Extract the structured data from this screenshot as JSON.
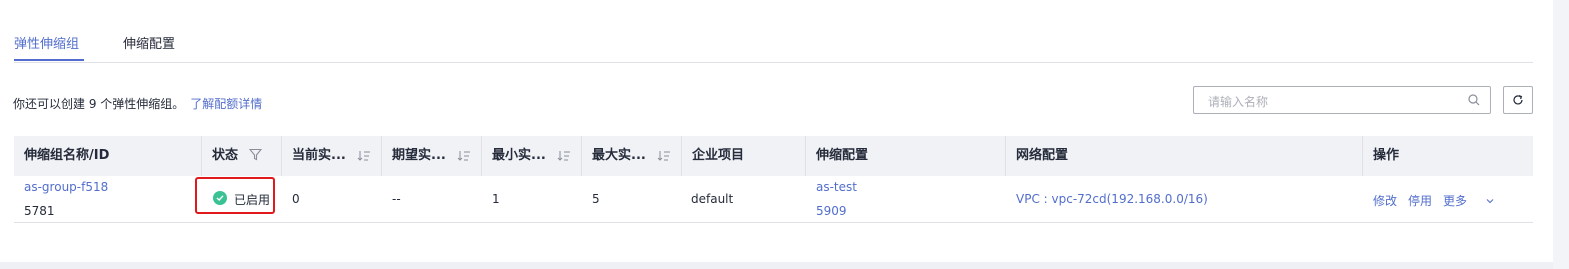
{
  "tabs": {
    "active": "弹性伸缩组",
    "other": "伸缩配置"
  },
  "info": {
    "text": "你还可以创建 9 个弹性伸缩组。",
    "link": "了解配额详情"
  },
  "search": {
    "placeholder": "请输入名称"
  },
  "table": {
    "headers": {
      "name": "伸缩组名称/ID",
      "status": "状态",
      "current": "当前实...",
      "desired": "期望实...",
      "min": "最小实...",
      "max": "最大实...",
      "project": "企业项目",
      "config": "伸缩配置",
      "network": "网络配置",
      "ops": "操作"
    },
    "row": {
      "name": "as-group-f518",
      "id": "5781",
      "status": "已启用",
      "current": "0",
      "desired": "--",
      "min": "1",
      "max": "5",
      "project": "default",
      "config_name": "as-test",
      "config_id": "5909",
      "network": "VPC : vpc-72cd(192.168.0.0/16)",
      "op_modify": "修改",
      "op_disable": "停用",
      "op_more": "更多"
    }
  },
  "colors": {
    "accent": "#526ecc",
    "status_green": "#3ac295",
    "highlight_red": "#e0191d"
  }
}
